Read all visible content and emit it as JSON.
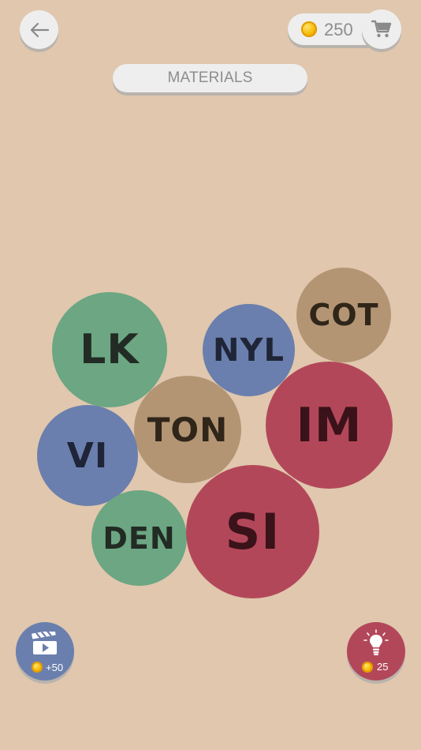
{
  "header": {
    "coins": "250",
    "category": "MATERIALS"
  },
  "bubbles": [
    {
      "text": "LK",
      "color": "#6ca683"
    },
    {
      "text": "NYL",
      "color": "#6a7fad"
    },
    {
      "text": "COT",
      "color": "#b39574"
    },
    {
      "text": "TON",
      "color": "#b39574"
    },
    {
      "text": "IM",
      "color": "#b3475a"
    },
    {
      "text": "VI",
      "color": "#6a7fad"
    },
    {
      "text": "DEN",
      "color": "#6ca683"
    },
    {
      "text": "SI",
      "color": "#b3475a"
    }
  ],
  "footer": {
    "video_reward": "+50",
    "hint_cost": "25"
  },
  "icons": {
    "back": "arrow-left-icon",
    "coin": "coin-icon",
    "cart": "cart-icon",
    "video": "clapperboard-icon",
    "hint": "lightbulb-icon"
  },
  "colors": {
    "background": "#e0c7ad",
    "green": "#6ca683",
    "blue": "#6a7fad",
    "tan": "#b39574",
    "red": "#b3475a"
  }
}
